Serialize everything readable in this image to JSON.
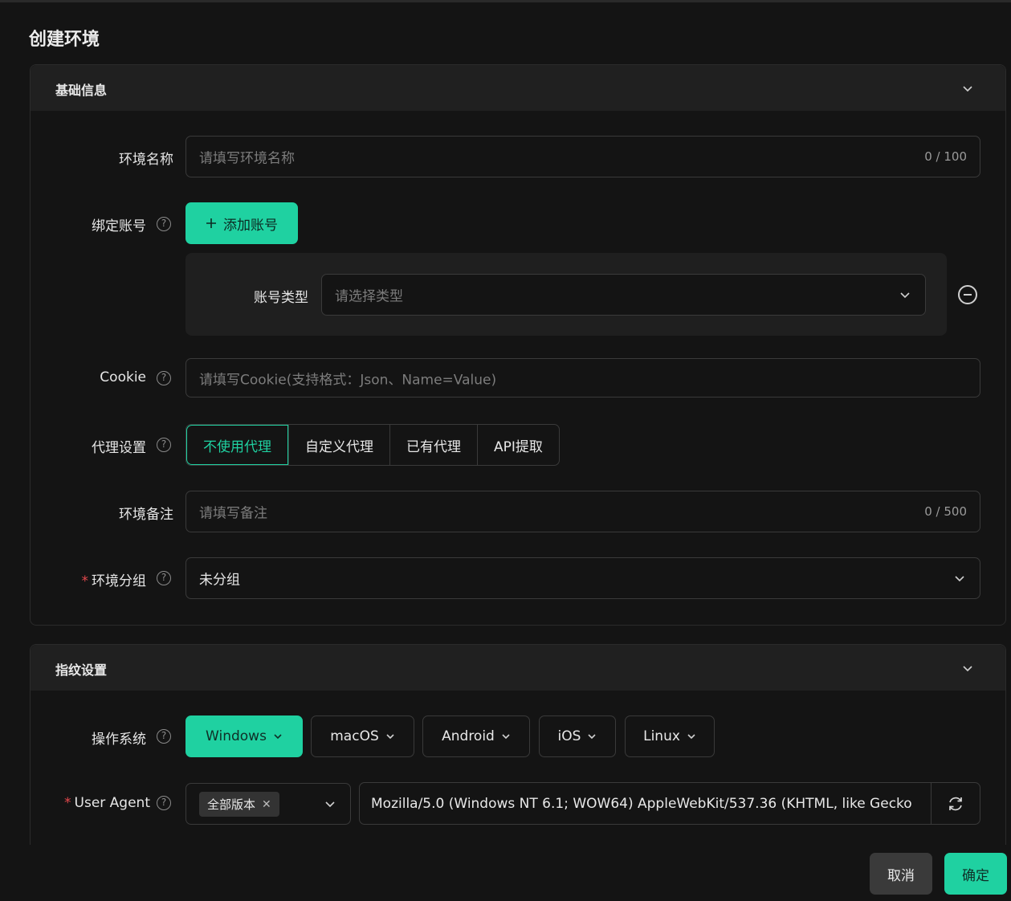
{
  "dialog": {
    "title": "创建环境"
  },
  "basic": {
    "section_title": "基础信息",
    "env_name": {
      "label": "环境名称",
      "placeholder": "请填写环境名称",
      "count": "0 / 100"
    },
    "bind_account": {
      "label": "绑定账号",
      "add_button": "添加账号",
      "type_label": "账号类型",
      "type_placeholder": "请选择类型"
    },
    "cookie": {
      "label": "Cookie",
      "placeholder": "请填写Cookie(支持格式：Json、Name=Value)"
    },
    "proxy": {
      "label": "代理设置",
      "options": [
        "不使用代理",
        "自定义代理",
        "已有代理",
        "API提取"
      ],
      "selected": "不使用代理"
    },
    "remark": {
      "label": "环境备注",
      "placeholder": "请填写备注",
      "count": "0 / 500"
    },
    "group": {
      "required_mark": "*",
      "label": "环境分组",
      "value": "未分组"
    }
  },
  "fingerprint": {
    "section_title": "指纹设置",
    "os": {
      "label": "操作系统",
      "options": [
        "Windows",
        "macOS",
        "Android",
        "iOS",
        "Linux"
      ],
      "selected": "Windows"
    },
    "user_agent": {
      "required_mark": "*",
      "label": "User Agent",
      "version_tag": "全部版本",
      "value": "Mozilla/5.0 (Windows NT 6.1; WOW64) AppleWebKit/537.36 (KHTML, like Gecko"
    }
  },
  "footer": {
    "cancel": "取消",
    "ok": "确定"
  },
  "colors": {
    "accent": "#1fd1a1",
    "background": "#141414",
    "required": "#e5484d"
  }
}
